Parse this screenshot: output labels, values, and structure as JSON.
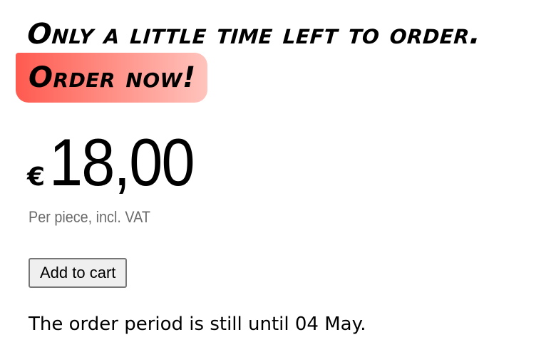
{
  "promo": {
    "headline": "Only a little time left to order.",
    "cta_text": "Order now!"
  },
  "price": {
    "currency_symbol": "€",
    "amount": "18,00",
    "note": "Per piece, incl. VAT"
  },
  "actions": {
    "add_to_cart_label": "Add to cart"
  },
  "order_period": {
    "text": "The order period is still until 04 May."
  },
  "colors": {
    "cta_gradient_start": "#ff5a50",
    "cta_gradient_end": "#ffc4bd",
    "note_text": "#6b6b6b"
  }
}
